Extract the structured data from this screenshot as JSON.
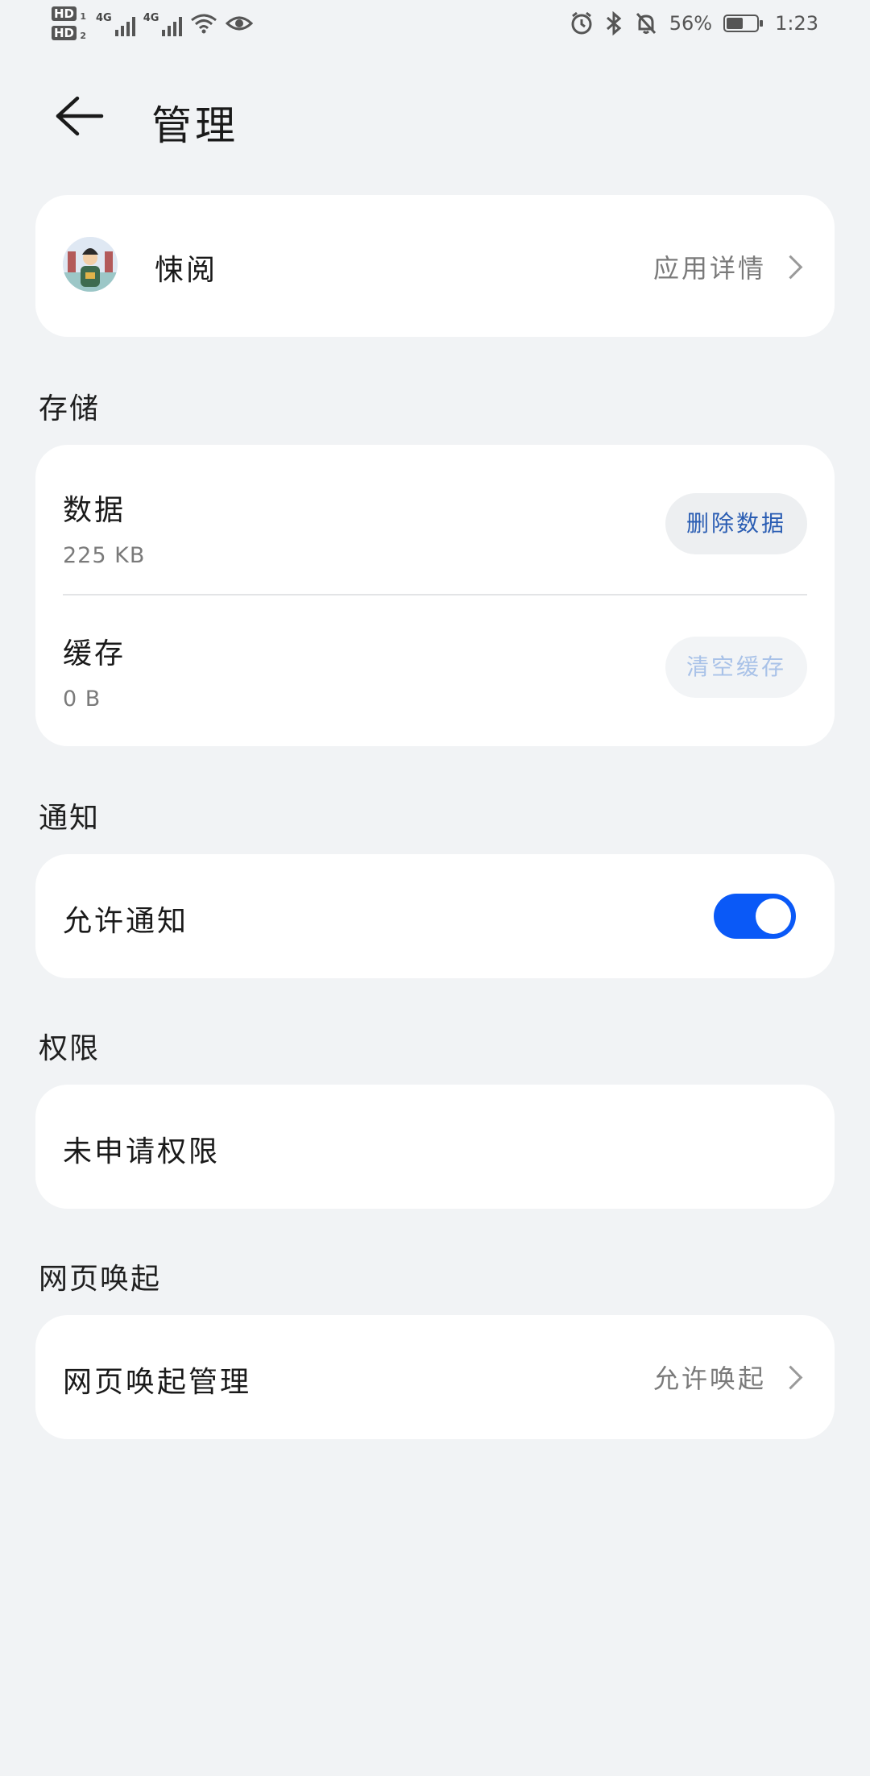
{
  "status_bar": {
    "sim1": "HD",
    "sim1_index": "1",
    "sim2": "HD",
    "sim2_index": "2",
    "net1": "4G",
    "net2": "4G",
    "battery_percent": "56%",
    "battery_level": 0.56,
    "time": "1:23"
  },
  "header": {
    "title": "管理"
  },
  "app": {
    "name": "悚阅",
    "details_label": "应用详情"
  },
  "storage": {
    "section_label": "存储",
    "data_title": "数据",
    "data_size": "225 KB",
    "delete_button": "删除数据",
    "cache_title": "缓存",
    "cache_size": "0 B",
    "clear_cache_button": "清空缓存"
  },
  "notifications": {
    "section_label": "通知",
    "allow_label": "允许通知",
    "allow_enabled": true
  },
  "permissions": {
    "section_label": "权限",
    "none_label": "未申请权限"
  },
  "web_launch": {
    "section_label": "网页唤起",
    "manage_label": "网页唤起管理",
    "manage_value": "允许唤起"
  },
  "colors": {
    "accent": "#0a59f7",
    "background": "#f1f3f5",
    "card": "#ffffff"
  }
}
